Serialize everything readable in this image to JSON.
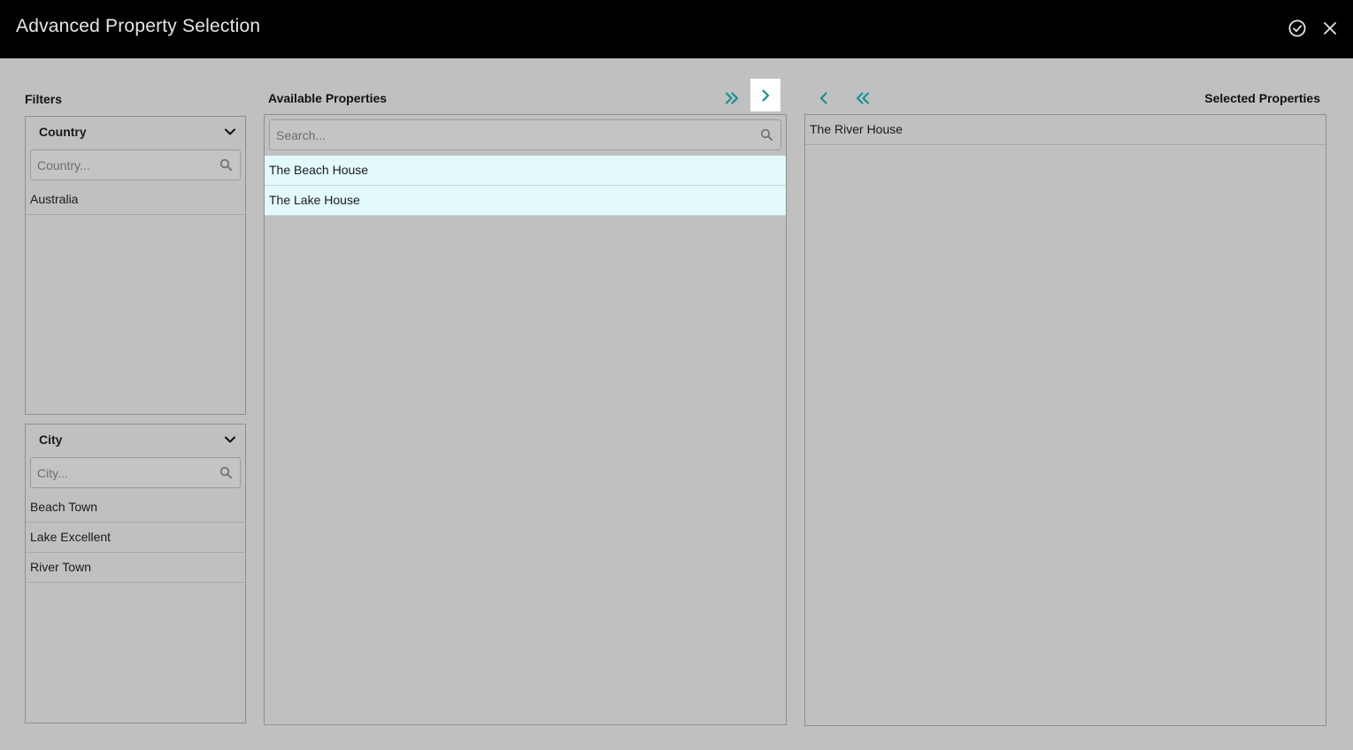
{
  "window": {
    "title": "Advanced Property Selection",
    "confirm_icon": "check-circle-icon",
    "close_icon": "close-icon"
  },
  "filters": {
    "label": "Filters",
    "country": {
      "title": "Country",
      "placeholder": "Country...",
      "items": [
        "Australia"
      ]
    },
    "city": {
      "title": "City",
      "placeholder": "City...",
      "items": [
        "Beach Town",
        "Lake Excellent",
        "River Town"
      ]
    }
  },
  "available": {
    "label": "Available Properties",
    "search_placeholder": "Search...",
    "items": [
      "The Beach House",
      "The Lake House"
    ]
  },
  "selected": {
    "label": "Selected Properties",
    "items": [
      "The River House"
    ]
  },
  "colors": {
    "accent": "#13928f",
    "highlight_row": "#e3fafd",
    "title_bar": "#000000",
    "background": "#c0c0c0"
  }
}
